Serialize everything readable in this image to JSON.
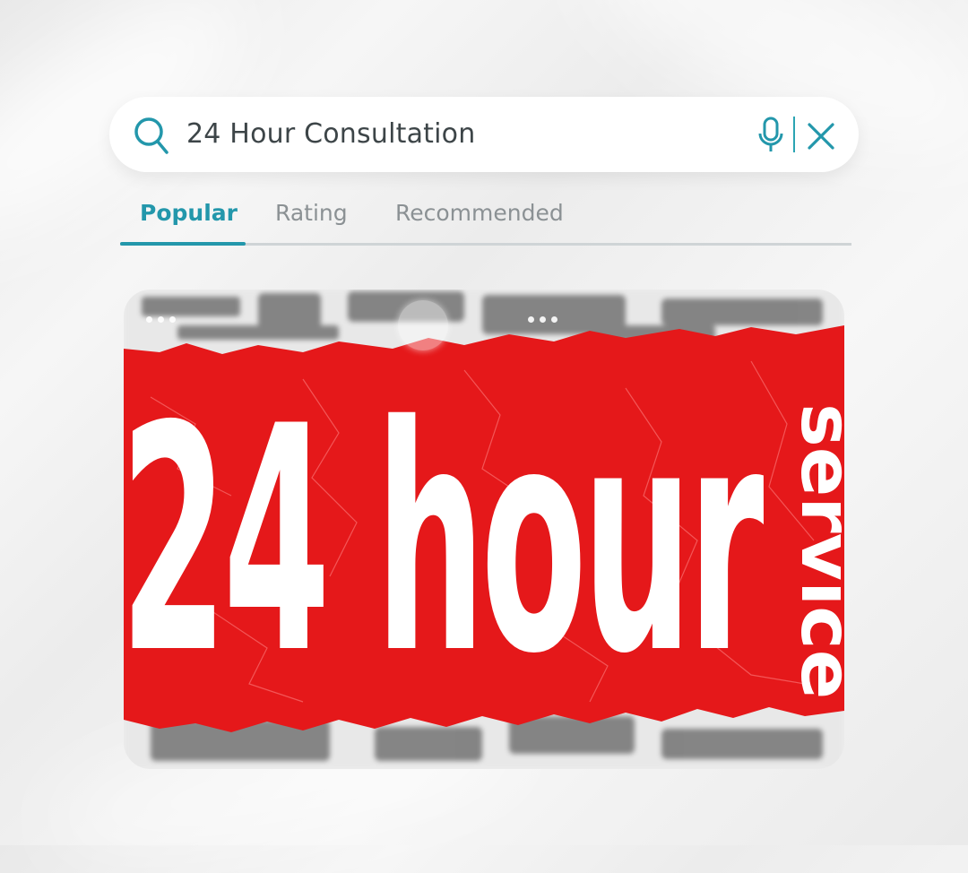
{
  "search": {
    "query": "24 Hour Consultation",
    "icon": "search-icon",
    "mic_icon": "microphone-icon",
    "clear_icon": "close-icon",
    "accent": "#2397ab"
  },
  "tabs": [
    {
      "label": "Popular",
      "active": true
    },
    {
      "label": "Rating",
      "active": false
    },
    {
      "label": "Recommended",
      "active": false
    }
  ],
  "banner": {
    "headline": "24 hour",
    "side_text": "service",
    "background_color": "#e5181a"
  }
}
